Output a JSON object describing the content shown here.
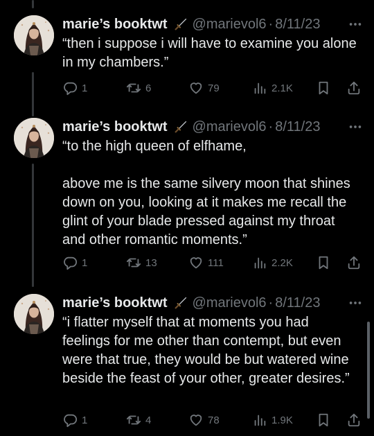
{
  "tweets": [
    {
      "name": "marie’s booktwt",
      "handle": "@marievol6",
      "separator": "·",
      "date": "8/11/23",
      "text": "“then i suppose i will have to examine you alone in my chambers.”",
      "replies": "1",
      "reposts": "6",
      "likes": "79",
      "views": "2.1K"
    },
    {
      "name": "marie’s booktwt",
      "handle": "@marievol6",
      "separator": "·",
      "date": "8/11/23",
      "text": "“to the high queen of elfhame,\n\nabove me is the same silvery moon that shines down on you, looking at it makes me recall the glint of your blade pressed against my throat and other romantic moments.”",
      "replies": "1",
      "reposts": "13",
      "likes": "111",
      "views": "2.2K"
    },
    {
      "name": "marie’s booktwt",
      "handle": "@marievol6",
      "separator": "·",
      "date": "8/11/23",
      "text": "“i flatter myself that at moments you had feelings for me other than contempt, but even were that true, they would be but watered wine beside the feast of your other, greater desires.”",
      "replies": "1",
      "reposts": "4",
      "likes": "78",
      "views": "1.9K"
    }
  ],
  "icons": {
    "verified_emoji": "dagger-icon",
    "more": "more-icon",
    "reply": "reply-icon",
    "repost": "repost-icon",
    "like": "heart-icon",
    "views": "views-icon",
    "bookmark": "bookmark-icon",
    "share": "share-icon"
  },
  "colors": {
    "background": "#000000",
    "primary_text": "#e7e9ea",
    "secondary_text": "#71767b",
    "thread_line": "#333639"
  }
}
